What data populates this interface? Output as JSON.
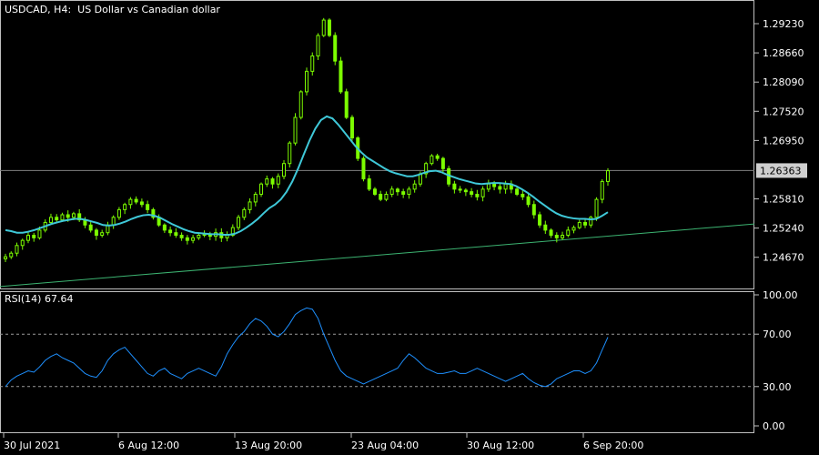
{
  "window": {
    "symbol_title": "USDCAD, H4:  US Dollar vs Canadian dollar",
    "current_price_label": "1.26363"
  },
  "colors": {
    "background": "#000000",
    "candle": "#7cfc00",
    "ma_line": "#3fc8d8",
    "trendline": "#3cb371",
    "price_line": "#808080",
    "rsi_line": "#1e90ff",
    "grid_dashed": "#9a9a9a",
    "axis": "#bfbfbf",
    "price_box_bg": "#cfcfcf",
    "price_box_text": "#000000"
  },
  "chart_data": [
    {
      "type": "candlestick",
      "name": "price",
      "y_ticks": [
        "1.29230",
        "1.28660",
        "1.28090",
        "1.27520",
        "1.26950",
        "1.26363",
        "1.25810",
        "1.25240",
        "1.24670"
      ],
      "ylim": [
        1.2415,
        1.2955
      ],
      "current_price": 1.26363,
      "x_tick_labels": [
        "30 Jul 2021",
        "6 Aug 12:00",
        "13 Aug 20:00",
        "23 Aug 04:00",
        "30 Aug 12:00",
        "6 Sep 20:00"
      ],
      "close_series": [
        1.2468,
        1.2475,
        1.249,
        1.25,
        1.251,
        1.2505,
        1.252,
        1.2535,
        1.2545,
        1.254,
        1.255,
        1.2545,
        1.2552,
        1.254,
        1.253,
        1.252,
        1.251,
        1.2515,
        1.253,
        1.2545,
        1.256,
        1.257,
        1.258,
        1.2575,
        1.257,
        1.256,
        1.2545,
        1.253,
        1.252,
        1.2515,
        1.251,
        1.2505,
        1.25,
        1.2505,
        1.251,
        1.2512,
        1.2508,
        1.2515,
        1.2505,
        1.251,
        1.2525,
        1.2545,
        1.256,
        1.2575,
        1.259,
        1.261,
        1.262,
        1.261,
        1.2625,
        1.265,
        1.269,
        1.274,
        1.279,
        1.283,
        1.286,
        1.29,
        1.293,
        1.29,
        1.285,
        1.279,
        1.274,
        1.27,
        1.266,
        1.262,
        1.26,
        1.259,
        1.258,
        1.259,
        1.26,
        1.2595,
        1.259,
        1.26,
        1.261,
        1.263,
        1.265,
        1.2665,
        1.266,
        1.264,
        1.261,
        1.26,
        1.2598,
        1.2595,
        1.259,
        1.2585,
        1.26,
        1.261,
        1.2605,
        1.26,
        1.261,
        1.26,
        1.259,
        1.2585,
        1.257,
        1.255,
        1.253,
        1.252,
        1.251,
        1.2505,
        1.251,
        1.252,
        1.2525,
        1.2535,
        1.253,
        1.2545,
        1.258,
        1.2615,
        1.2636
      ],
      "ma_series": [
        1.252,
        1.2518,
        1.2515,
        1.2515,
        1.2517,
        1.252,
        1.2524,
        1.2528,
        1.2532,
        1.2535,
        1.2538,
        1.254,
        1.2542,
        1.2542,
        1.254,
        1.2537,
        1.2534,
        1.253,
        1.2529,
        1.253,
        1.2533,
        1.2537,
        1.2542,
        1.2546,
        1.2549,
        1.255,
        1.2548,
        1.2544,
        1.2538,
        1.2532,
        1.2527,
        1.2522,
        1.2518,
        1.2515,
        1.2514,
        1.2513,
        1.2512,
        1.2512,
        1.2511,
        1.2511,
        1.2513,
        1.2518,
        1.2525,
        1.2533,
        1.2542,
        1.2553,
        1.2563,
        1.257,
        1.258,
        1.2595,
        1.2615,
        1.264,
        1.2668,
        1.2695,
        1.2718,
        1.2735,
        1.2742,
        1.2738,
        1.2726,
        1.2712,
        1.2698,
        1.2684,
        1.2672,
        1.2662,
        1.2655,
        1.2648,
        1.2641,
        1.2635,
        1.2631,
        1.2628,
        1.2625,
        1.2625,
        1.2628,
        1.2632,
        1.2635,
        1.2636,
        1.2633,
        1.2628,
        1.2624,
        1.262,
        1.2617,
        1.2614,
        1.2611,
        1.261,
        1.2611,
        1.2612,
        1.2612,
        1.2611,
        1.261,
        1.2606,
        1.26,
        1.2593,
        1.2585,
        1.2576,
        1.2568,
        1.256,
        1.2553,
        1.2548,
        1.2545,
        1.2543,
        1.2542,
        1.2542,
        1.2541,
        1.2542,
        1.2548,
        1.2555
      ],
      "trendline": {
        "start": 1.241,
        "end": 1.2532
      }
    },
    {
      "type": "line",
      "name": "RSI(14) 67.64",
      "y_ticks": [
        "100.00",
        "70.00",
        "30.00",
        "0.00"
      ],
      "ylim": [
        0,
        100
      ],
      "levels": [
        70,
        30
      ],
      "values": [
        30,
        35,
        38,
        40,
        42,
        41,
        45,
        50,
        53,
        55,
        52,
        50,
        48,
        44,
        40,
        38,
        37,
        42,
        50,
        55,
        58,
        60,
        55,
        50,
        45,
        40,
        38,
        42,
        44,
        40,
        38,
        36,
        40,
        42,
        44,
        42,
        40,
        38,
        45,
        55,
        62,
        68,
        72,
        78,
        82,
        80,
        76,
        70,
        68,
        72,
        78,
        85,
        88,
        90,
        89,
        82,
        70,
        60,
        50,
        42,
        38,
        36,
        34,
        32,
        34,
        36,
        38,
        40,
        42,
        44,
        50,
        55,
        52,
        48,
        44,
        42,
        40,
        40,
        41,
        42,
        40,
        40,
        42,
        44,
        42,
        40,
        38,
        36,
        34,
        36,
        38,
        40,
        36,
        33,
        31,
        30,
        32,
        36,
        38,
        40,
        42,
        42,
        40,
        42,
        48,
        58,
        67.64
      ]
    }
  ]
}
